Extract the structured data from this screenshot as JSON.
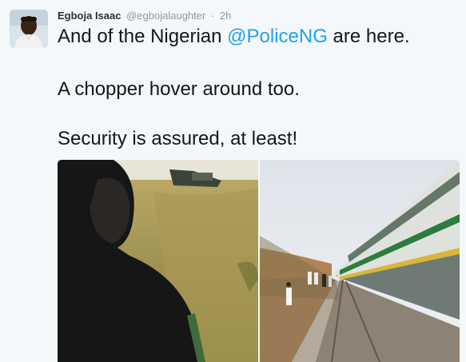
{
  "tweet": {
    "author_name": "Egboja Isaac",
    "handle": "@egbojalaughter",
    "separator": "·",
    "timestamp": "2h",
    "text_line_1_before": "And of the Nigerian ",
    "mention": "@PoliceNG",
    "text_line_1_after": " are here.",
    "text_line_2": "A chopper hover around too.",
    "text_line_3": "Security is assured, at least!"
  },
  "media": {
    "photo_1_icon": "photo-police-officer-in-field",
    "photo_2_icon": "photo-train-on-tracks"
  },
  "colors": {
    "link": "#1da1f2",
    "text": "#14171a",
    "name": "#292f33",
    "meta": "#8899a6",
    "background": "#f5f8fa"
  }
}
